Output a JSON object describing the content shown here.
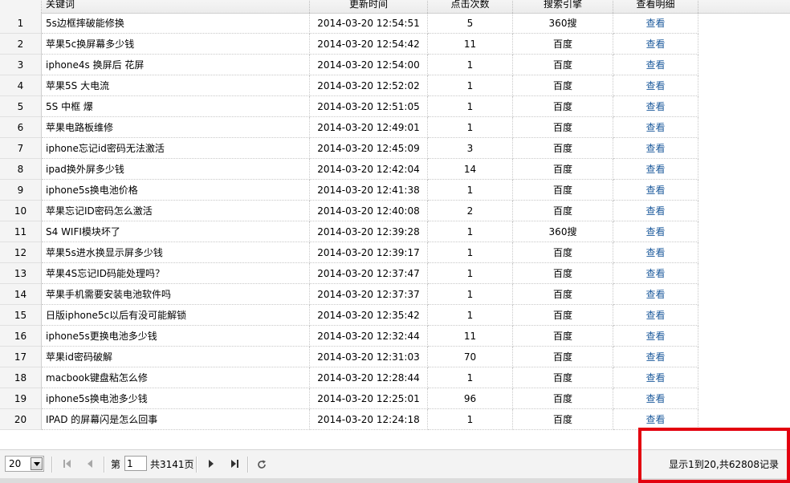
{
  "columns": {
    "keyword": "关键词",
    "updated": "更新时间",
    "clicks": "点击次数",
    "engine": "搜索引擎",
    "details": "查看明细"
  },
  "rows": [
    {
      "num": "1",
      "keyword": "5s边框摔破能修换",
      "time": "2014-03-20 12:54:51",
      "clicks": "5",
      "engine": "360搜",
      "view": "查看"
    },
    {
      "num": "2",
      "keyword": "苹果5c换屏幕多少钱",
      "time": "2014-03-20 12:54:42",
      "clicks": "11",
      "engine": "百度",
      "view": "查看"
    },
    {
      "num": "3",
      "keyword": "iphone4s 换屏后 花屏",
      "time": "2014-03-20 12:54:00",
      "clicks": "1",
      "engine": "百度",
      "view": "查看"
    },
    {
      "num": "4",
      "keyword": "苹果5S 大电流",
      "time": "2014-03-20 12:52:02",
      "clicks": "1",
      "engine": "百度",
      "view": "查看"
    },
    {
      "num": "5",
      "keyword": "5S 中框 爆",
      "time": "2014-03-20 12:51:05",
      "clicks": "1",
      "engine": "百度",
      "view": "查看"
    },
    {
      "num": "6",
      "keyword": "苹果电路板维修",
      "time": "2014-03-20 12:49:01",
      "clicks": "1",
      "engine": "百度",
      "view": "查看"
    },
    {
      "num": "7",
      "keyword": "iphone忘记id密码无法激活",
      "time": "2014-03-20 12:45:09",
      "clicks": "3",
      "engine": "百度",
      "view": "查看"
    },
    {
      "num": "8",
      "keyword": "ipad换外屏多少钱",
      "time": "2014-03-20 12:42:04",
      "clicks": "14",
      "engine": "百度",
      "view": "查看"
    },
    {
      "num": "9",
      "keyword": "iphone5s换电池价格",
      "time": "2014-03-20 12:41:38",
      "clicks": "1",
      "engine": "百度",
      "view": "查看"
    },
    {
      "num": "10",
      "keyword": "苹果忘记ID密码怎么激活",
      "time": "2014-03-20 12:40:08",
      "clicks": "2",
      "engine": "百度",
      "view": "查看"
    },
    {
      "num": "11",
      "keyword": "S4 WIFI模块坏了",
      "time": "2014-03-20 12:39:28",
      "clicks": "1",
      "engine": "360搜",
      "view": "查看"
    },
    {
      "num": "12",
      "keyword": "苹果5s进水换显示屏多少钱",
      "time": "2014-03-20 12:39:17",
      "clicks": "1",
      "engine": "百度",
      "view": "查看"
    },
    {
      "num": "13",
      "keyword": "苹果4S忘记ID码能处理吗？",
      "time": "2014-03-20 12:37:47",
      "clicks": "1",
      "engine": "百度",
      "view": "查看"
    },
    {
      "num": "14",
      "keyword": "苹果手机需要安装电池软件吗",
      "time": "2014-03-20 12:37:37",
      "clicks": "1",
      "engine": "百度",
      "view": "查看"
    },
    {
      "num": "15",
      "keyword": "日版iphone5c以后有没可能解锁",
      "time": "2014-03-20 12:35:42",
      "clicks": "1",
      "engine": "百度",
      "view": "查看"
    },
    {
      "num": "16",
      "keyword": "iphone5s更换电池多少钱",
      "time": "2014-03-20 12:32:44",
      "clicks": "11",
      "engine": "百度",
      "view": "查看"
    },
    {
      "num": "17",
      "keyword": "苹果id密码破解",
      "time": "2014-03-20 12:31:03",
      "clicks": "70",
      "engine": "百度",
      "view": "查看"
    },
    {
      "num": "18",
      "keyword": "macbook键盘粘怎么修",
      "time": "2014-03-20 12:28:44",
      "clicks": "1",
      "engine": "百度",
      "view": "查看"
    },
    {
      "num": "19",
      "keyword": "iphone5s换电池多少钱",
      "time": "2014-03-20 12:25:01",
      "clicks": "96",
      "engine": "百度",
      "view": "查看"
    },
    {
      "num": "20",
      "keyword": "IPAD 的屏幕闪是怎么回事",
      "time": "2014-03-20 12:24:18",
      "clicks": "1",
      "engine": "百度",
      "view": "查看"
    }
  ],
  "pager": {
    "page_size": "20",
    "page_prefix": "第",
    "page_value": "1",
    "page_total": "共3141页",
    "summary": "显示1到20,共62808记录"
  },
  "icons": {
    "first": "first-page-icon",
    "prev": "prev-page-icon",
    "next": "next-page-icon",
    "last": "last-page-icon",
    "refresh": "refresh-icon",
    "dropdown": "chevron-down-icon"
  },
  "colors": {
    "link": "#1c5a9c",
    "highlight": "#e3000f"
  }
}
